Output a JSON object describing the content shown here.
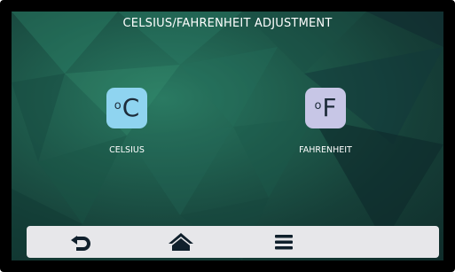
{
  "header": {
    "title": "CELSIUS/FAHRENHEIT ADJUSTMENT"
  },
  "options": [
    {
      "unit_symbol": "C",
      "degree_symbol": "o",
      "label": "CELSIUS",
      "color": "#8fd4f0"
    },
    {
      "unit_symbol": "F",
      "degree_symbol": "o",
      "label": "FAHRENHEIT",
      "color": "#c7c6e6"
    }
  ],
  "navbar": {
    "items": [
      {
        "icon": "back-arrow-icon"
      },
      {
        "icon": "home-icon"
      },
      {
        "icon": "menu-icon"
      }
    ],
    "background": "#e7e7ea"
  },
  "theme": {
    "screen_background": "#1e5a4b",
    "bezel": "#000000"
  }
}
